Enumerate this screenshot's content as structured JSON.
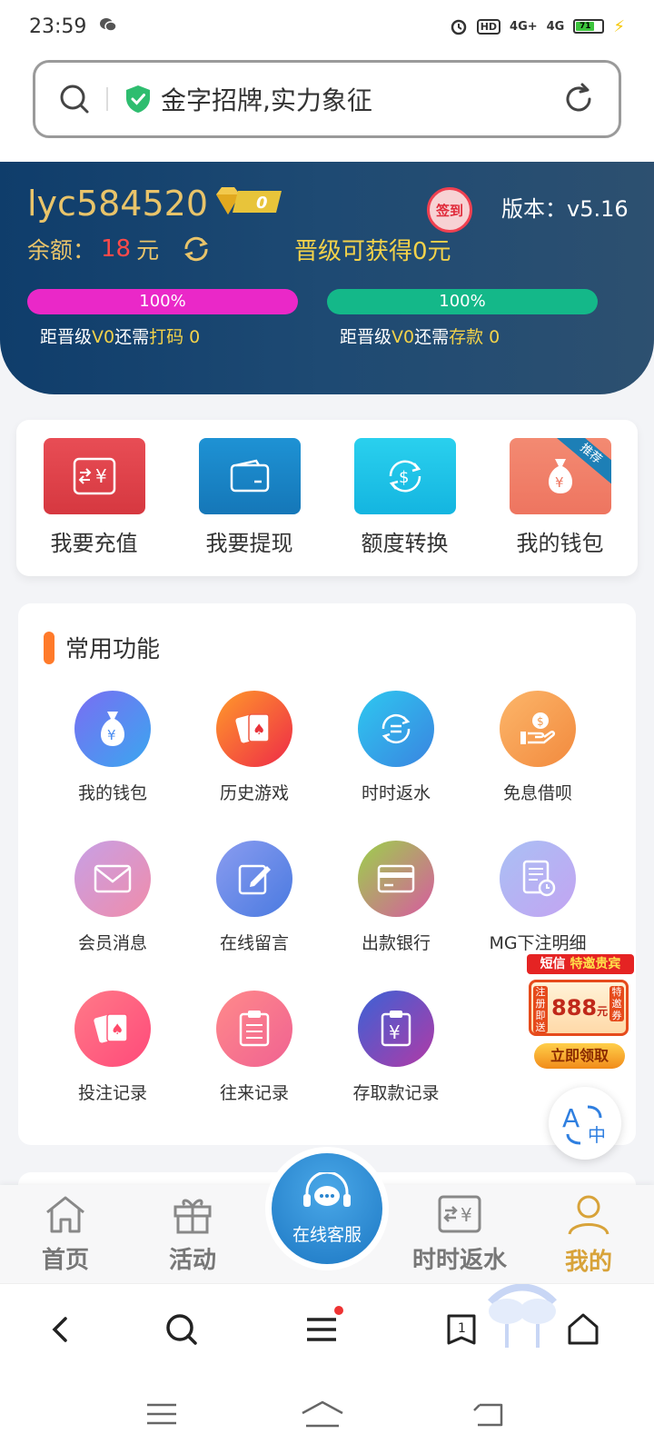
{
  "status_bar": {
    "time": "23:59",
    "network_1": "4G+",
    "network_2": "4G",
    "hd": "HD",
    "battery": "71"
  },
  "search": {
    "text": "金字招牌,实力象征"
  },
  "account": {
    "username": "lyc584520",
    "vip_level": "0",
    "sign_in": "签到",
    "version": "版本：v5.16",
    "balance_label": "余额：",
    "balance_value": "18",
    "balance_unit": "元",
    "promo": "晋级可获得0元",
    "bet_progress": "100%",
    "bet_progress_value": 100,
    "deposit_progress": "100%",
    "deposit_progress_value": 100,
    "bet_note_prefix": "距晋级",
    "bet_note_level": "V0",
    "bet_note_mid": "还需",
    "bet_note_tail": "打码 0",
    "deposit_note_prefix": "距晋级",
    "deposit_note_level": "V0",
    "deposit_note_mid": "还需",
    "deposit_note_tail": "存款 0"
  },
  "quick_actions": [
    {
      "label": "我要充值",
      "icon": "exchange-yen-icon",
      "color": "#e0434b"
    },
    {
      "label": "我要提现",
      "icon": "wallet-icon",
      "color": "#1a86c8"
    },
    {
      "label": "额度转换",
      "icon": "dollar-cycle-icon",
      "color": "#1ec4e8"
    },
    {
      "label": "我的钱包",
      "icon": "money-bag-icon",
      "color": "#f2826e",
      "ribbon": "推荐"
    }
  ],
  "common": {
    "title": "常用功能",
    "items": [
      {
        "label": "我的钱包",
        "icon": "money-bag-icon"
      },
      {
        "label": "历史游戏",
        "icon": "playing-cards-icon"
      },
      {
        "label": "时时返水",
        "icon": "cycle-icon"
      },
      {
        "label": "免息借呗",
        "icon": "hand-coin-icon"
      },
      {
        "label": "会员消息",
        "icon": "mail-icon"
      },
      {
        "label": "在线留言",
        "icon": "edit-note-icon"
      },
      {
        "label": "出款银行",
        "icon": "bank-card-icon"
      },
      {
        "label": "MG下注明细",
        "icon": "document-clock-icon"
      },
      {
        "label": "投注记录",
        "icon": "cards-icon"
      },
      {
        "label": "往来记录",
        "icon": "clipboard-list-icon"
      },
      {
        "label": "存取款记录",
        "icon": "clipboard-yen-icon"
      }
    ]
  },
  "float_promo": {
    "top_1": "短信",
    "top_2": "特邀贵宾",
    "side_left": "注册即送",
    "amount": "888",
    "amount_unit": "元",
    "side_right": "特邀券",
    "button": "立即领取"
  },
  "bottom_nav": {
    "home": "首页",
    "activity": "活动",
    "service": "在线客服",
    "rebate": "时时返水",
    "mine": "我的"
  },
  "browser": {
    "tabs_count": "1"
  }
}
